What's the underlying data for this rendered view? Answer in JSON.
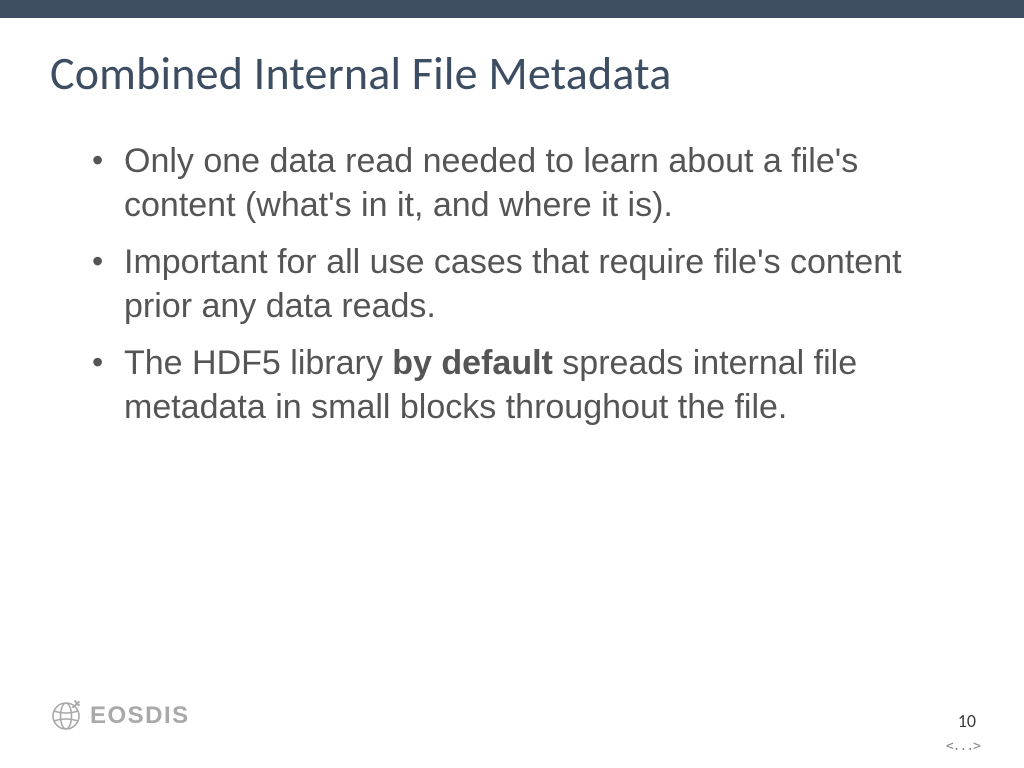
{
  "title": "Combined Internal File Metadata",
  "bullets": [
    {
      "pre": "Only one data read needed to learn about a file's content (what's in it, and where it is).",
      "bold": "",
      "post": ""
    },
    {
      "pre": "Important for all use cases that require file's content prior any data reads.",
      "bold": "",
      "post": ""
    },
    {
      "pre": "The HDF5 library ",
      "bold": "by default",
      "post": " spreads internal file metadata in small blocks throughout the file."
    }
  ],
  "footer": {
    "logo_text": "EOSDIS",
    "page_number": "10",
    "nav_indicator": "<...>"
  },
  "colors": {
    "accent": "#3d4e63",
    "body_text": "#555555",
    "muted": "#a8a9aa"
  }
}
